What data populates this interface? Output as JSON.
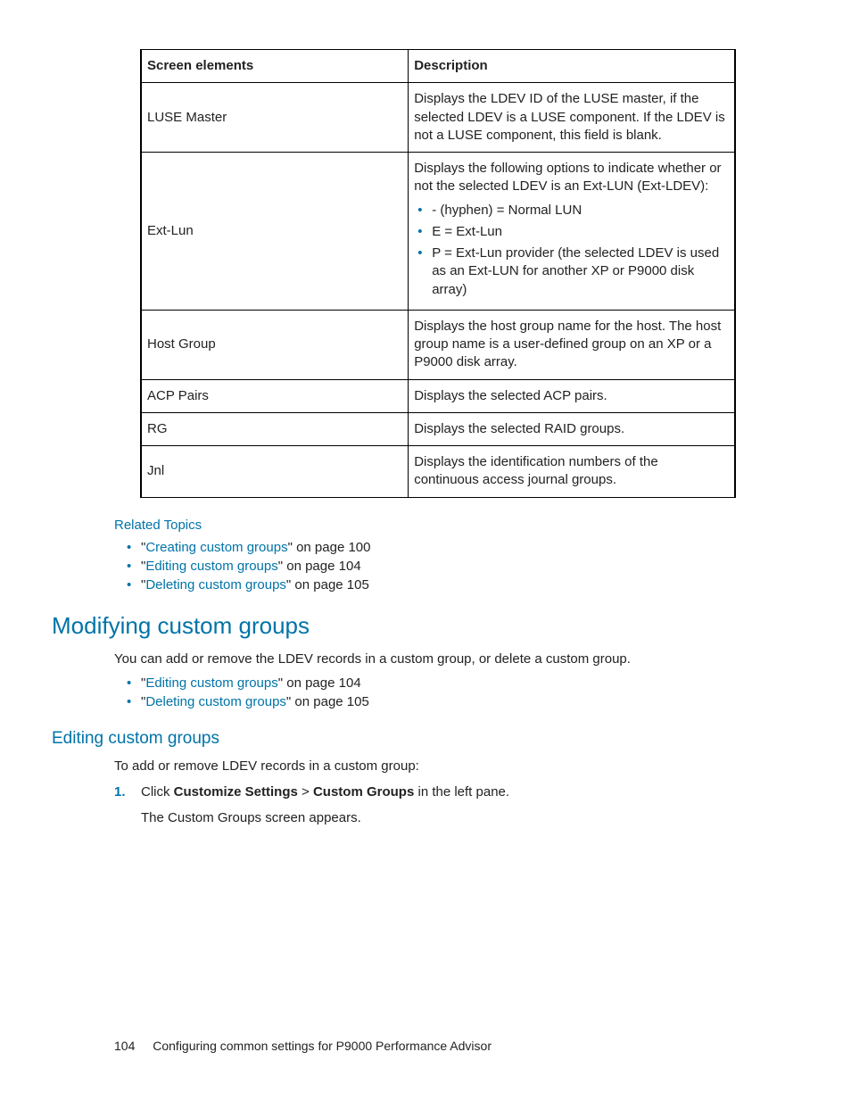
{
  "table": {
    "headers": {
      "col1": "Screen elements",
      "col2": "Description"
    },
    "rows": [
      {
        "element": "LUSE Master",
        "desc": "Displays the LDEV ID of the LUSE master, if the selected LDEV is a LUSE component. If the LDEV is not a LUSE component, this field is blank."
      },
      {
        "element": "Ext-Lun",
        "desc_intro": "Displays the following options to indicate whether or not the selected LDEV is an Ext-LUN (Ext-LDEV):",
        "bullets": [
          "- (hyphen) = Normal LUN",
          "E = Ext-Lun",
          "P = Ext-Lun provider (the selected LDEV is used as an Ext-LUN for another XP or P9000 disk array)"
        ]
      },
      {
        "element": "Host Group",
        "desc": "Displays the host group name for the host. The host group name is a user-defined group on an XP or a P9000 disk array."
      },
      {
        "element": "ACP Pairs",
        "desc": "Displays the selected ACP pairs."
      },
      {
        "element": "RG",
        "desc": "Displays the selected RAID groups."
      },
      {
        "element": "Jnl",
        "desc": "Displays the identification numbers of the continuous access journal groups."
      }
    ]
  },
  "related_topics_label": "Related Topics",
  "related_links": [
    {
      "pre": "\"",
      "link": "Creating custom groups",
      "post": "\" on page 100"
    },
    {
      "pre": "\"",
      "link": "Editing custom groups",
      "post": "\" on page 104"
    },
    {
      "pre": "\"",
      "link": "Deleting custom groups",
      "post": "\" on page 105"
    }
  ],
  "section1": {
    "heading": "Modifying custom groups",
    "para": "You can add or remove the LDEV records in a custom group, or delete a custom group.",
    "links": [
      {
        "pre": "\"",
        "link": "Editing custom groups",
        "post": "\" on page 104"
      },
      {
        "pre": "\"",
        "link": "Deleting custom groups",
        "post": "\" on page 105"
      }
    ]
  },
  "section2": {
    "heading": "Editing custom groups",
    "para": "To add or remove LDEV records in a custom group:",
    "steps": [
      {
        "num": "1.",
        "pre": "Click ",
        "b1": "Customize Settings",
        "mid": " > ",
        "b2": "Custom Groups",
        "post": " in the left pane.",
        "after": "The Custom Groups screen appears."
      }
    ]
  },
  "footer": {
    "page_number": "104",
    "title": "Configuring common settings for P9000 Performance Advisor"
  }
}
